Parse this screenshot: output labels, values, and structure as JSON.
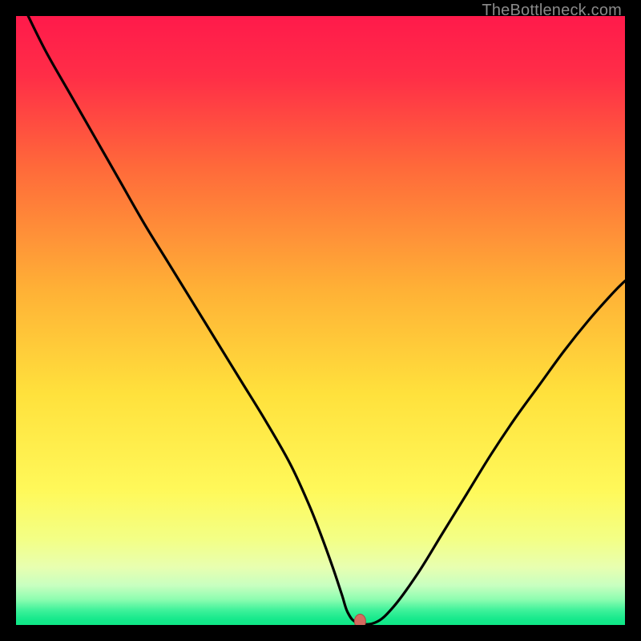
{
  "watermark": "TheBottleneck.com",
  "colors": {
    "black": "#000000",
    "curve": "#000000",
    "marker_fill": "#d46a5f",
    "marker_stroke": "#a84b42"
  },
  "chart_data": {
    "type": "line",
    "title": "",
    "xlabel": "",
    "ylabel": "",
    "xlim": [
      0,
      100
    ],
    "ylim": [
      0,
      100
    ],
    "background_gradient": {
      "stops": [
        {
          "pos": 0.0,
          "color": "#ff1a4b"
        },
        {
          "pos": 0.1,
          "color": "#ff2e47"
        },
        {
          "pos": 0.25,
          "color": "#ff6a3a"
        },
        {
          "pos": 0.45,
          "color": "#ffb136"
        },
        {
          "pos": 0.62,
          "color": "#ffe13c"
        },
        {
          "pos": 0.78,
          "color": "#fff95a"
        },
        {
          "pos": 0.86,
          "color": "#f3ff86"
        },
        {
          "pos": 0.905,
          "color": "#e8ffb0"
        },
        {
          "pos": 0.935,
          "color": "#c8ffc0"
        },
        {
          "pos": 0.958,
          "color": "#8dfdb0"
        },
        {
          "pos": 0.975,
          "color": "#41f29b"
        },
        {
          "pos": 0.99,
          "color": "#17e98c"
        },
        {
          "pos": 1.0,
          "color": "#0fe786"
        }
      ]
    },
    "series": [
      {
        "name": "bottleneck-curve",
        "x": [
          2,
          5,
          9,
          13,
          17,
          21,
          25,
          29,
          33,
          37,
          41,
          45,
          48,
          50,
          52,
          53.5,
          54.5,
          56,
          59,
          62,
          66,
          70,
          74,
          78,
          82,
          86,
          90,
          94,
          98,
          100
        ],
        "y": [
          100,
          94,
          87,
          80,
          73,
          66,
          59.5,
          53,
          46.5,
          40,
          33.5,
          26.5,
          20,
          15,
          9.5,
          5,
          2,
          0.4,
          0.4,
          3,
          8.5,
          15,
          21.5,
          28,
          34,
          39.5,
          45,
          50,
          54.5,
          56.5
        ]
      }
    ],
    "marker": {
      "x": 56.5,
      "y": 0.6
    }
  }
}
